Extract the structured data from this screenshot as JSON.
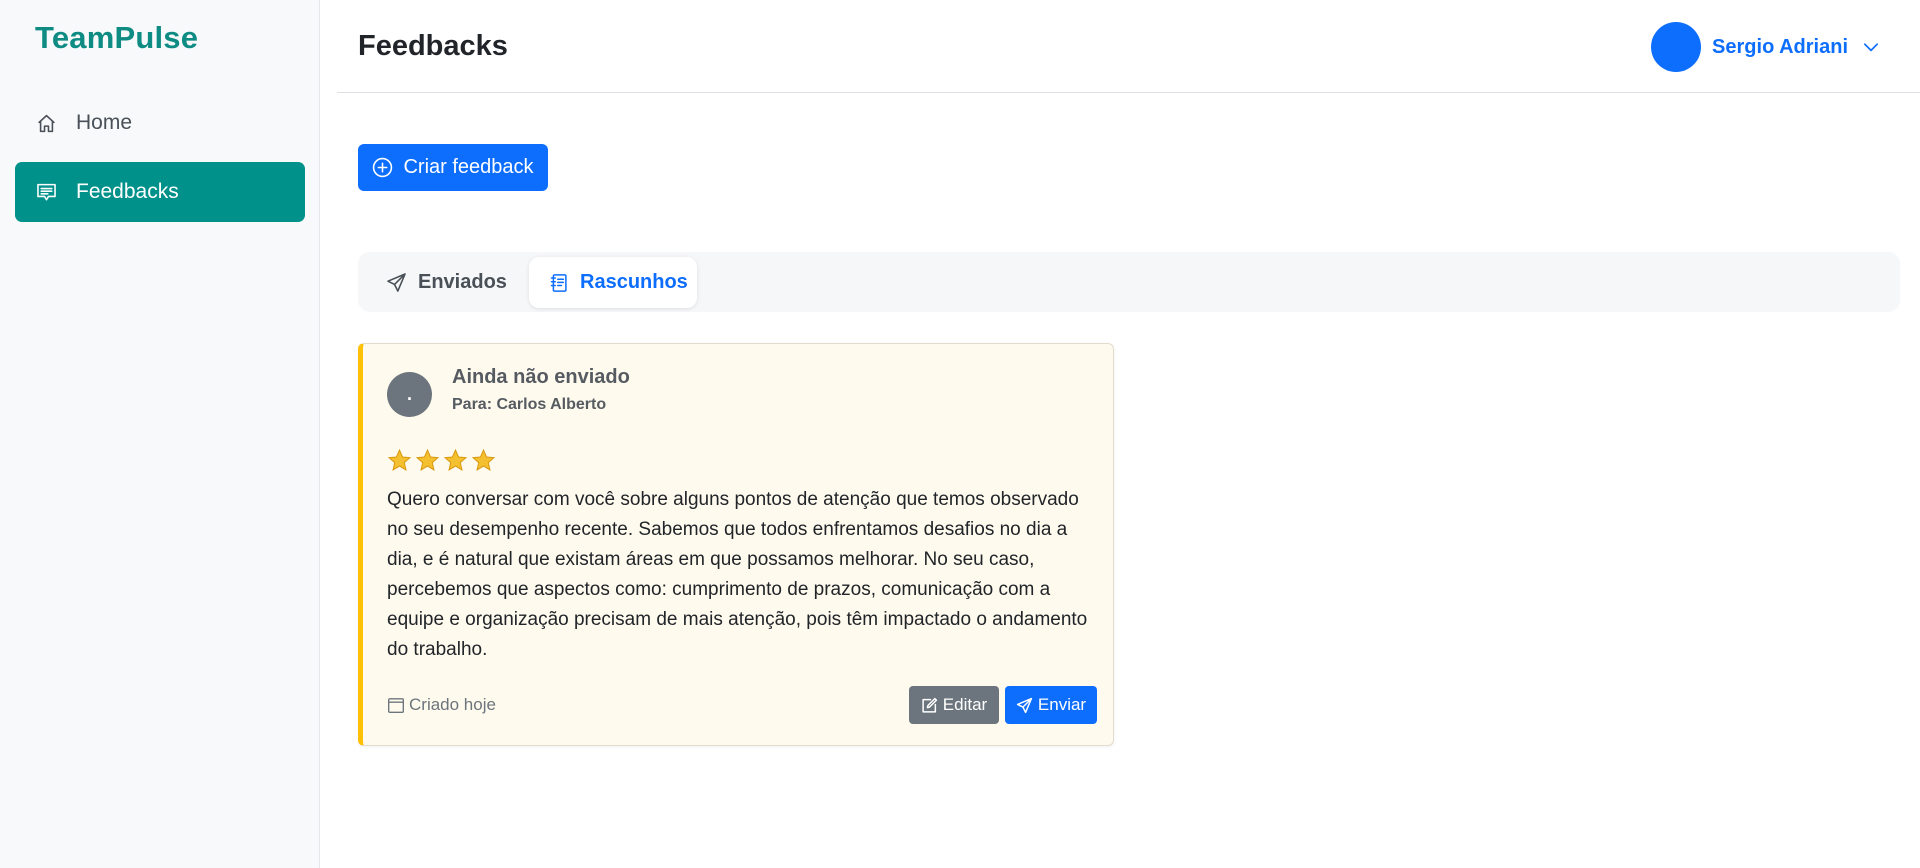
{
  "app": {
    "brand": "TeamPulse"
  },
  "sidebar": {
    "items": [
      {
        "label": "Home",
        "icon": "house-icon",
        "active": false
      },
      {
        "label": "Feedbacks",
        "icon": "chat-square-text-icon",
        "active": true
      }
    ]
  },
  "header": {
    "title": "Feedbacks",
    "user": {
      "name": "Sergio Adriani"
    }
  },
  "actions": {
    "create_label": "Criar feedback"
  },
  "tabs": [
    {
      "label": "Enviados",
      "icon": "send-icon",
      "active": false
    },
    {
      "label": "Rascunhos",
      "icon": "journal-text-icon",
      "active": true
    }
  ],
  "draft_card": {
    "avatar_initial": ".",
    "status": "Ainda não enviado",
    "recipient": "Para: Carlos Alberto",
    "rating": 4,
    "text": "Quero conversar com você sobre alguns pontos de atenção que temos observado no seu desempenho recente. Sabemos que todos enfrentamos desafios no dia a dia, e é natural que existam áreas em que possamos melhorar. No seu caso, percebemos que aspectos como: cumprimento de prazos, comunicação com a equipe e organização precisam de mais atenção, pois têm impactado o andamento do trabalho.",
    "created": "Criado hoje",
    "edit_label": "Editar",
    "send_label": "Enviar"
  },
  "colors": {
    "brand": "#0e8c83",
    "sidebar_active": "#00918a",
    "primary": "#0d6efd",
    "secondary": "#6c757d",
    "draft_accent": "#ffc107",
    "draft_bg": "#fffaee"
  }
}
